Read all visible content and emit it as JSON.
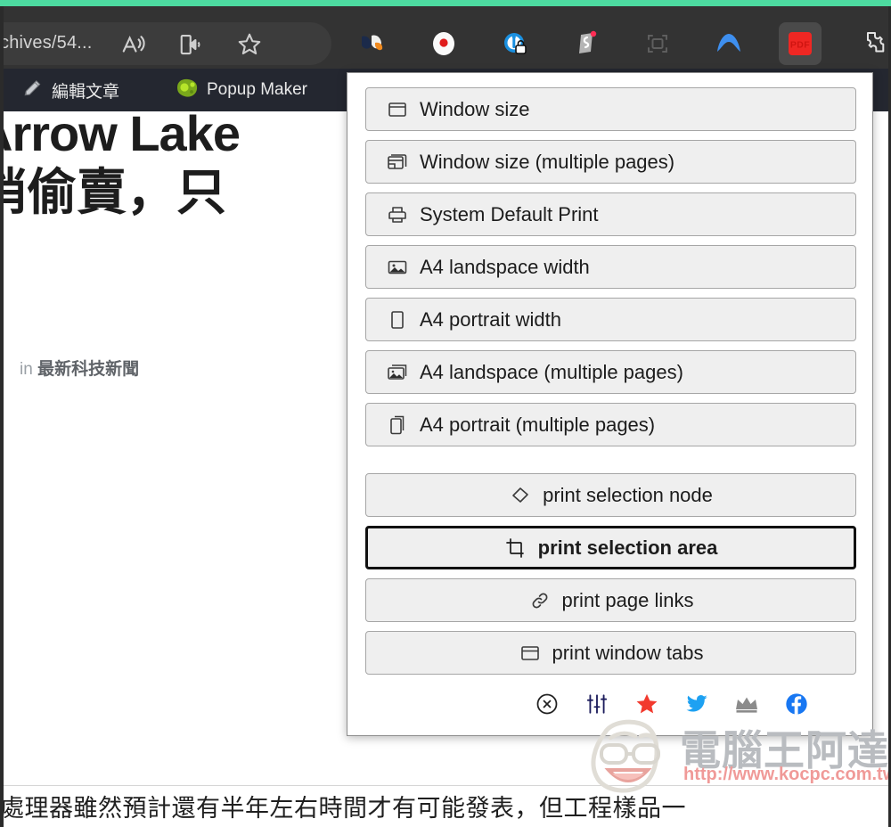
{
  "browser": {
    "accent_color": "#4ddba0",
    "omnibox": {
      "url_text": "chives/54...",
      "icons": [
        {
          "name": "read-aloud-icon",
          "glyph": "A"
        },
        {
          "name": "immersive-reader-icon",
          "glyph": "book"
        },
        {
          "name": "favorite-star-icon",
          "glyph": "star"
        }
      ]
    },
    "extension_icons": [
      {
        "name": "extension-icon-colorful-bird",
        "label": "",
        "active": false
      },
      {
        "name": "extension-icon-screen-recorder",
        "label": "",
        "active": false
      },
      {
        "name": "extension-icon-privacy-lock",
        "label": "",
        "active": false
      },
      {
        "name": "extension-icon-scribe",
        "label": "",
        "active": false
      },
      {
        "name": "extension-icon-capture-frame",
        "label": "",
        "active": false
      },
      {
        "name": "extension-icon-nordvpn",
        "label": "",
        "active": false
      },
      {
        "name": "extension-icon-print-pdf",
        "label": "PDF",
        "active": true
      },
      {
        "name": "extensions-puzzle-icon",
        "label": "",
        "active": false
      }
    ],
    "bookmarks": [
      {
        "name": "bookmark-edit-post",
        "label": "編輯文章",
        "icon": "pencil-icon"
      },
      {
        "name": "bookmark-popup-maker",
        "label": "Popup Maker",
        "icon": "amoeba-icon"
      }
    ]
  },
  "page": {
    "headline_line1": "Arrow Lake",
    "headline_line2": "悄偷賣，只",
    "meta_prefix": "in ",
    "meta_category": "最新科技新聞",
    "body_text": "處理器雖然預計還有半年左右時間才有可能發表，但工程樣品一"
  },
  "panel": {
    "title": "",
    "groups": [
      {
        "name": "size-options",
        "items": [
          {
            "label": "Window size",
            "icon": "window-icon",
            "align": "left",
            "selected": false
          },
          {
            "label": "Window size (multiple pages)",
            "icon": "window-multi-icon",
            "align": "left",
            "selected": false
          },
          {
            "label": "System Default Print",
            "icon": "printer-icon",
            "align": "left",
            "selected": false
          },
          {
            "label": "A4 landspace width",
            "icon": "image-landscape-icon",
            "align": "left",
            "selected": false
          },
          {
            "label": "A4 portrait width",
            "icon": "page-portrait-icon",
            "align": "left",
            "selected": false
          },
          {
            "label": "A4 landspace (multiple pages)",
            "icon": "image-landscape-multi-icon",
            "align": "left",
            "selected": false
          },
          {
            "label": "A4 portrait (multiple pages)",
            "icon": "page-portrait-multi-icon",
            "align": "left",
            "selected": false
          }
        ]
      },
      {
        "name": "selection-options",
        "items": [
          {
            "label": "print selection node",
            "icon": "node-diamond-icon",
            "align": "center",
            "selected": false
          },
          {
            "label": "print selection area",
            "icon": "crop-area-icon",
            "align": "center",
            "selected": true
          },
          {
            "label": "print page links",
            "icon": "link-chain-icon",
            "align": "center",
            "selected": false
          },
          {
            "label": "print window tabs",
            "icon": "window-tabs-icon",
            "align": "center",
            "selected": false
          }
        ]
      }
    ],
    "footer_icons": [
      {
        "name": "close-circle-icon",
        "color": "#222222"
      },
      {
        "name": "sliders-settings-icon",
        "color": "#1c1c5c"
      },
      {
        "name": "star-rate-icon",
        "color": "#f23a2e"
      },
      {
        "name": "twitter-icon",
        "color": "#1da1f2"
      },
      {
        "name": "crown-premium-icon",
        "color": "#8b8b8b"
      },
      {
        "name": "facebook-icon",
        "color": "#1877f2"
      }
    ]
  },
  "watermark": {
    "brand": "電腦王阿達",
    "url": "http://www.kocpc.com.tw"
  }
}
